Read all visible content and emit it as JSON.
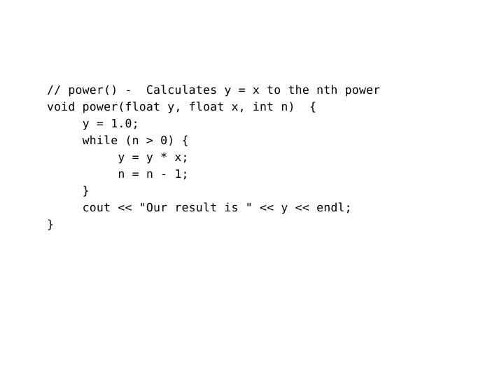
{
  "slide": {
    "background_color": "#ffffff",
    "text_color": "#000000",
    "language": "cpp"
  },
  "code": {
    "lines": [
      "// power() -  Calculates y = x to the nth power",
      "void power(float y, float x, int n)  {",
      "     y = 1.0;",
      "     while (n > 0) {",
      "          y = y * x;",
      "          n = n - 1;",
      "     }",
      "     cout << \"Our result is \" << y << endl;",
      "}"
    ],
    "line_01": "// power() -  Calculates y = x to the nth power",
    "line_02": "void power(float y, float x, int n)  {",
    "line_03": "     y = 1.0;",
    "line_04": "     while (n > 0) {",
    "line_05": "          y = y * x;",
    "line_06": "          n = n - 1;",
    "line_07": "     }",
    "line_08": "     cout << \"Our result is \" << y << endl;",
    "line_09": "}"
  }
}
